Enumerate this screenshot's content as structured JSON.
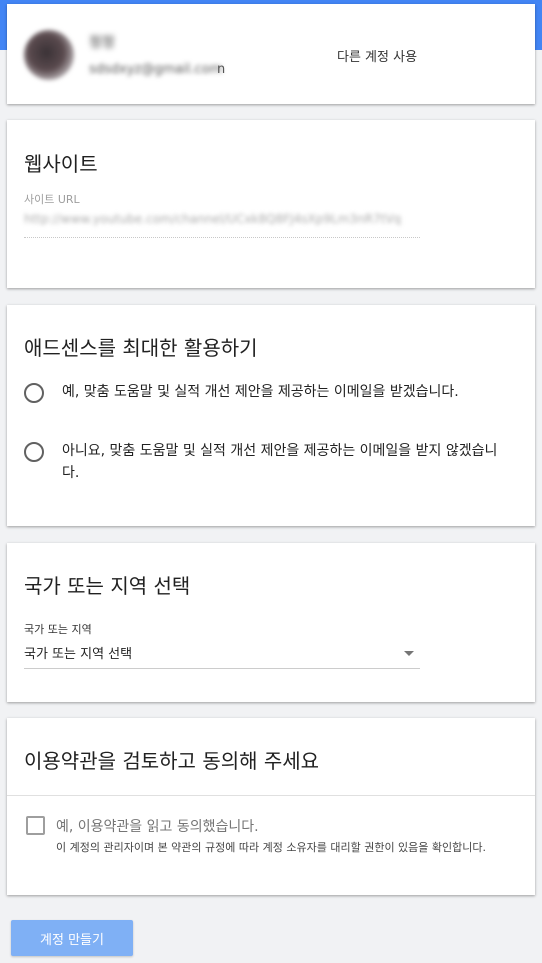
{
  "account": {
    "name": "정정",
    "email": "sdsdxyz@gmail.com",
    "email_tail": "n",
    "switch_label": "다른 계정 사용"
  },
  "website": {
    "title": "웹사이트",
    "url_label": "사이트 URL",
    "url_value": "http://www.youtube.com/channel/UCxk8Q8FJ4sXp9Lm3nR7tVq"
  },
  "adsense": {
    "title": "애드센스를 최대한 활용하기",
    "options": [
      {
        "label": "예, 맞춤 도움말 및 실적 개선 제안을 제공하는 이메일을 받겠습니다.",
        "selected": false
      },
      {
        "label": "아니요, 맞춤 도움말 및 실적 개선 제안을 제공하는 이메일을 받지 않겠습니다.",
        "selected": false
      }
    ]
  },
  "country": {
    "title": "국가 또는 지역 선택",
    "field_label": "국가 또는 지역",
    "selected_value": "국가 또는 지역 선택"
  },
  "terms": {
    "title": "이용약관을 검토하고 동의해 주세요",
    "checkbox_label": "예, 이용약관을 읽고 동의했습니다.",
    "sub_text": "이 계정의 관리자이며 본 약관의 규정에 따라 계정 소유자를 대리할 권한이 있음을 확인합니다.",
    "checked": false
  },
  "create_button_label": "계정 만들기",
  "colors": {
    "top_bar": "#4285f4",
    "button": "#7fb0f5",
    "background": "#f1f2f4"
  }
}
